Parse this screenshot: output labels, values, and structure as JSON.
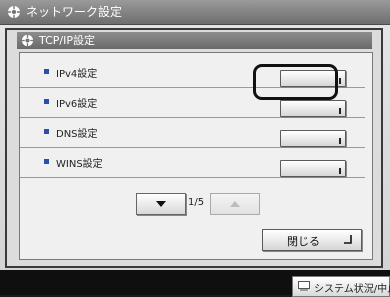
{
  "window": {
    "title": "ネットワーク設定",
    "icon": "network-settings-icon"
  },
  "panel": {
    "title": "TCP/IP設定",
    "icon": "network-settings-icon",
    "items": [
      {
        "label": "IPv4設定"
      },
      {
        "label": "IPv6設定",
        "highlighted": true
      },
      {
        "label": "DNS設定"
      },
      {
        "label": "WINS設定"
      }
    ]
  },
  "pager": {
    "indicator": "1/5"
  },
  "close_button": {
    "label": "閉じる"
  },
  "status_bar": {
    "button_label": "システム状況/中止"
  }
}
